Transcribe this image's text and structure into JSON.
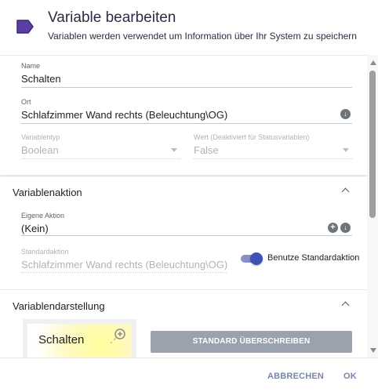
{
  "header": {
    "title": "Variable bearbeiten",
    "subtitle": "Variablen werden verwendet um Information über Ihr System zu speichern"
  },
  "general": {
    "name_label": "Name",
    "name_value": "Schalten",
    "location_label": "Ort",
    "location_value": "Schlafzimmer Wand rechts (Beleuchtung\\OG)",
    "type_label": "Variablentyp",
    "type_value": "Boolean",
    "value_label": "Wert (Deaktiviert für Statusvariablen)",
    "value_value": "False"
  },
  "action_section": {
    "title": "Variablenaktion",
    "own_action_label": "Eigene Aktion",
    "own_action_value": "(Kein)",
    "default_action_label": "Standardaktion",
    "default_action_value": "Schlafzimmer Wand rechts (Beleuchtung\\OG)",
    "toggle_label": "Benutze Standardaktion",
    "toggle_on": true
  },
  "display_section": {
    "title": "Variablendarstellung",
    "preview_text": "Schalten",
    "override_button": "STANDARD ÜBERSCHREIBEN"
  },
  "footer": {
    "cancel_label": "ABBRECHEN",
    "ok_label": "OK"
  },
  "colors": {
    "accent": "#3f51b5",
    "title": "#2b2d42",
    "footer_button": "#7985a4",
    "override_button_bg": "#9aa3ad"
  }
}
